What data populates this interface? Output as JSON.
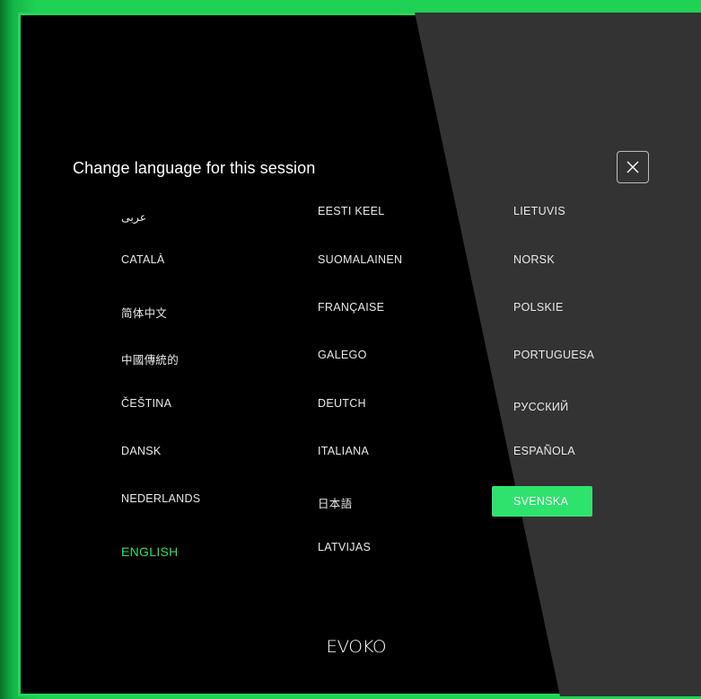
{
  "dialog": {
    "title": "Change language for this session",
    "close_icon": "close-icon"
  },
  "languages": {
    "col1": [
      "عربى",
      "CATALÀ",
      "简体中文",
      "中國傳統的",
      "ČEŠTINA",
      "DANSK",
      "NEDERLANDS",
      "ENGLISH"
    ],
    "col2": [
      "EESTI KEEL",
      "SUOMALAINEN",
      "FRANÇAISE",
      "GALEGO",
      "DEUTCH",
      "ITALIANA",
      "日本語",
      "LATVIJAS"
    ],
    "col3": [
      "LIETUVIS",
      "NORSK",
      "POLSKIE",
      "PORTUGUESA",
      "РУССКИЙ",
      "ESPAÑOLA",
      "SVENSKA"
    ]
  },
  "current_language": "ENGLISH",
  "highlighted_language": "SVENSKA",
  "brand": {
    "logo_text": "EVOKO"
  },
  "colors": {
    "accent": "#2ee36d",
    "border": "#22d65a",
    "background": "#000000",
    "panel": "#333333"
  }
}
